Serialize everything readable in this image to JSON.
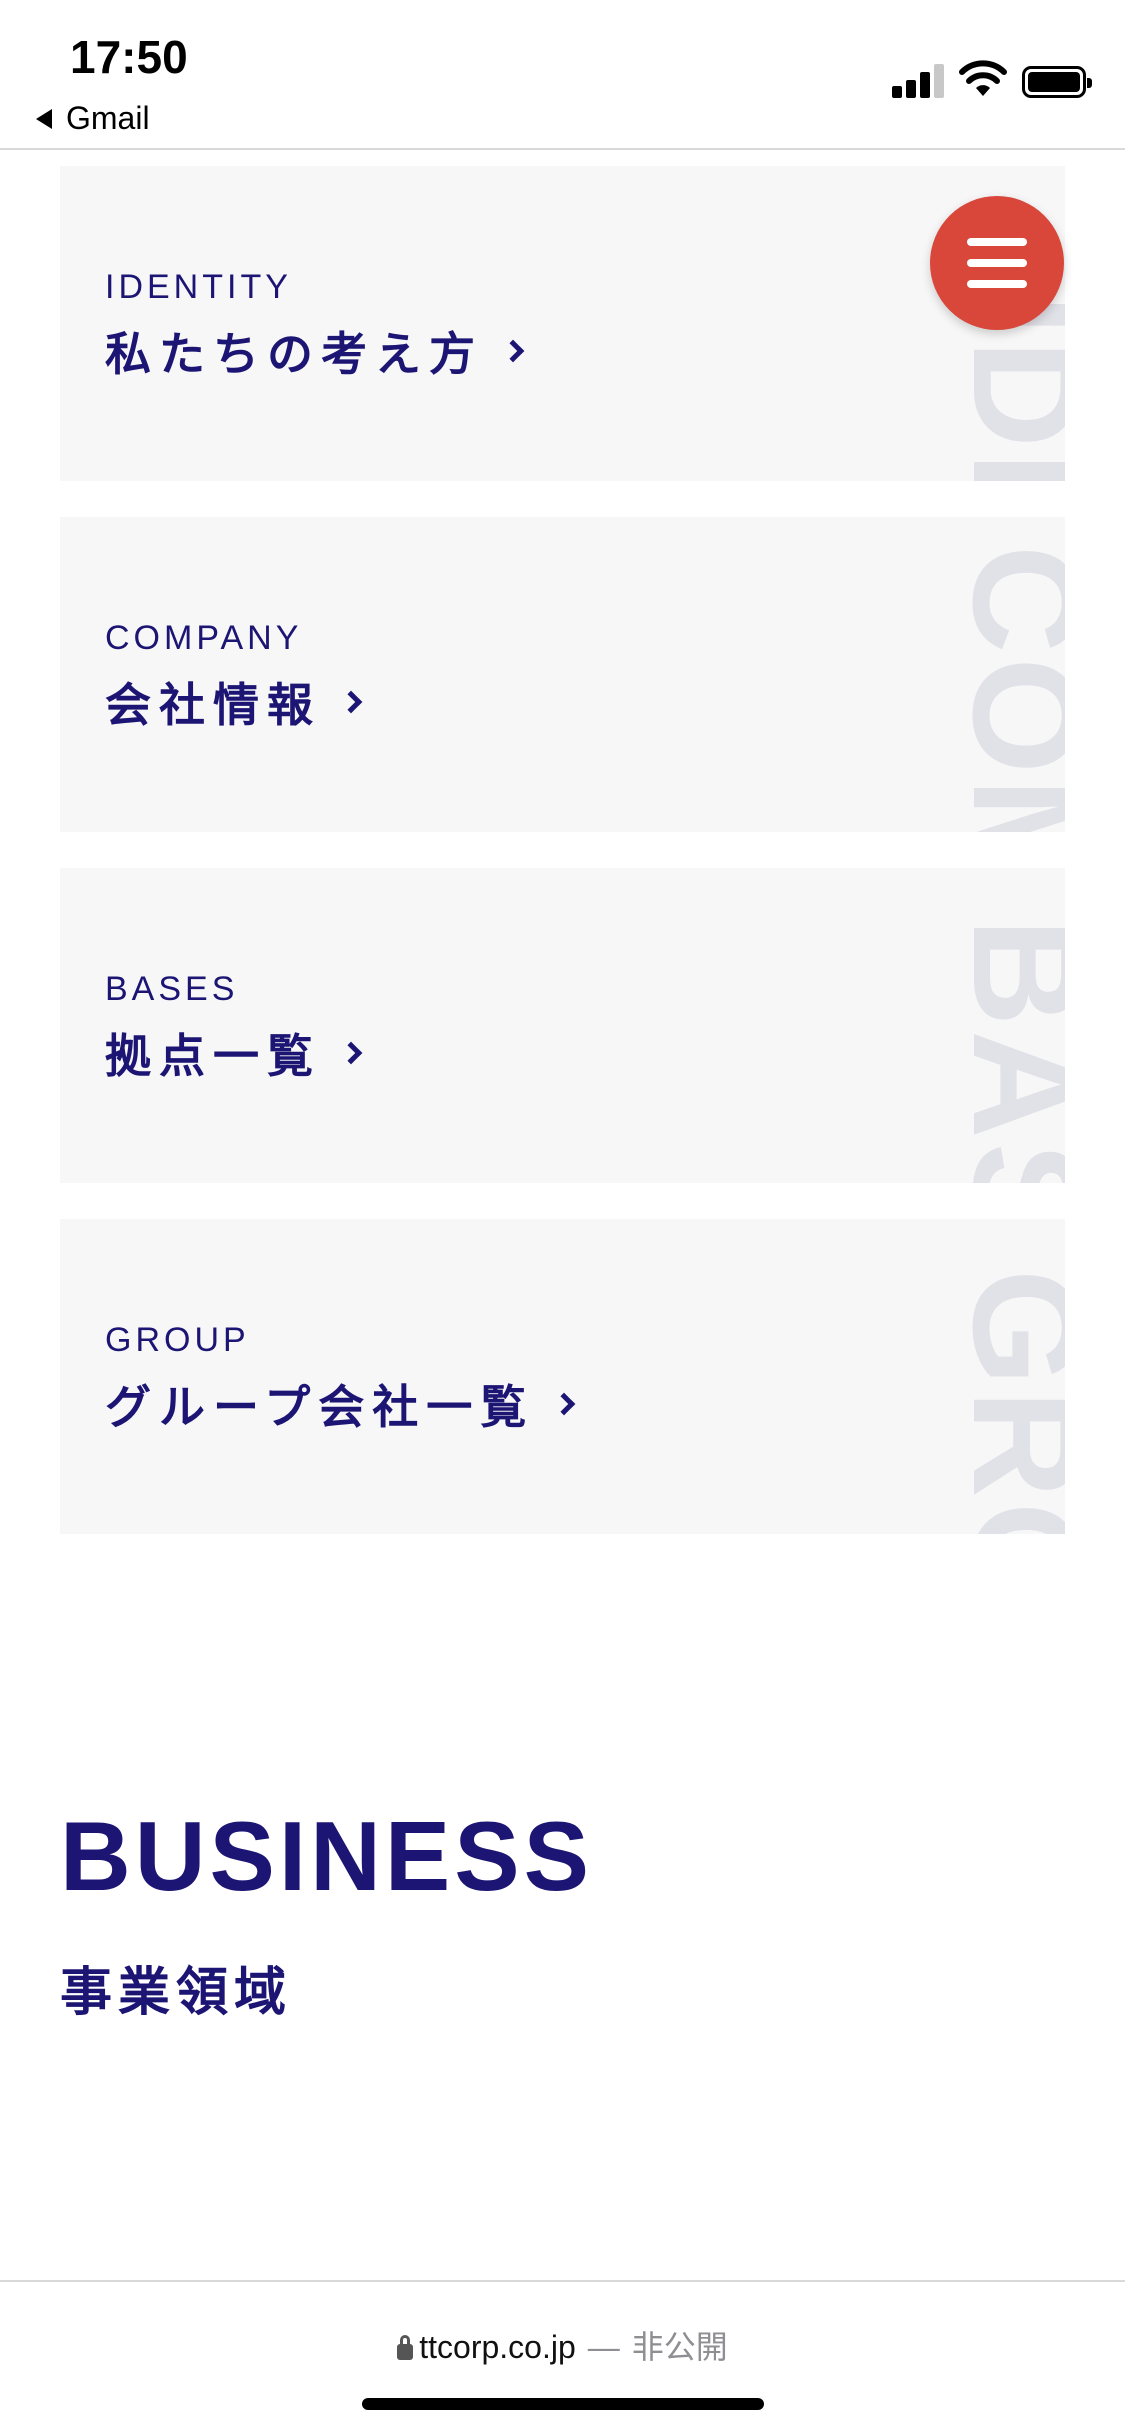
{
  "status_bar": {
    "time": "17:50",
    "back_app": "Gmail"
  },
  "menu_button": {
    "icon": "hamburger-menu-icon",
    "color": "#d8473a"
  },
  "cards": [
    {
      "en": "IDENTITY",
      "ja": "私たちの考え方",
      "watermark": "IDE"
    },
    {
      "en": "COMPANY",
      "ja": "会社情報",
      "watermark": "COM"
    },
    {
      "en": "BASES",
      "ja": "拠点一覧",
      "watermark": "BAS"
    },
    {
      "en": "GROUP",
      "ja": "グループ会社一覧",
      "watermark": "GRO"
    }
  ],
  "business": {
    "title": "BUSINESS",
    "subtitle": "事業領域"
  },
  "url_bar": {
    "domain": "ttcorp.co.jp",
    "separator": "—",
    "status": "非公開"
  },
  "colors": {
    "brand_navy": "#1c1573",
    "card_bg": "#f7f7f8",
    "accent_red": "#d8473a"
  }
}
